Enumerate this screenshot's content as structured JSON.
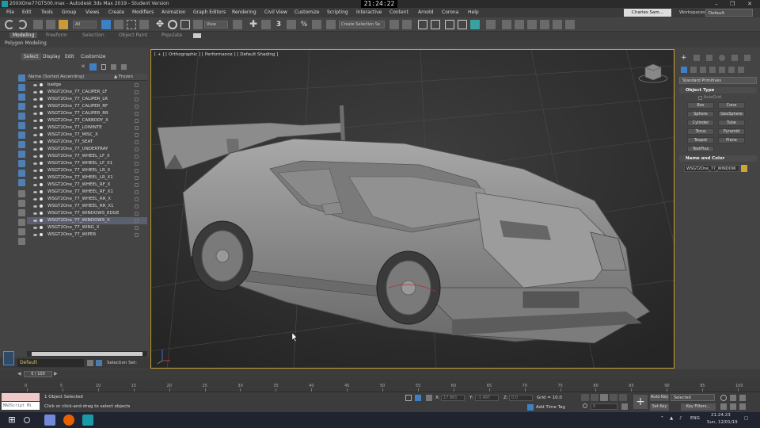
{
  "window": {
    "title": "20XXOne77GT500.max - Autodesk 3ds Max 2019 - Student Version",
    "clock": "21:24:22"
  },
  "menu": [
    "File",
    "Edit",
    "Tools",
    "Group",
    "Views",
    "Create",
    "Modifiers",
    "Animation",
    "Graph Editors",
    "Rendering",
    "Civil View",
    "Customize",
    "Scripting",
    "Interactive",
    "Content",
    "Arnold",
    "Corona",
    "Help"
  ],
  "user": {
    "name": "Charles Sam..."
  },
  "workspaces": {
    "label": "Workspaces:",
    "value": "Default"
  },
  "toolbar": {
    "filter_value": "All",
    "view_value": "View",
    "selection_set": "Create Selection Se"
  },
  "ribbon": {
    "tabs": [
      "Modeling",
      "Freeform",
      "Selection",
      "Object Paint",
      "Populate"
    ],
    "active": "Modeling",
    "sub": "Polygon Modeling"
  },
  "explorer": {
    "tabs": [
      "Select",
      "Display",
      "Edit",
      "Customize"
    ],
    "header_name": "Name (Sorted Ascending)",
    "header_frozen": "▲ Frozen",
    "items": [
      "badge",
      "WSGT2One_77_CALIPER_LF",
      "WSGT2One_77_CALIPER_LR",
      "WSGT2One_77_CALIPER_RF",
      "WSGT2One_77_CALIPER_RR",
      "WSGT2One_77_CARBODY_X",
      "WSGT2One_77_LOWINTE",
      "WSGT2One_77_MISC_X",
      "WSGT2One_77_SEAT",
      "WSGT2One_77_UNDERTRAY",
      "WSGT2One_77_WHEEL_LF_X",
      "WSGT2One_77_WHEEL_LF_X1",
      "WSGT2One_77_WHEEL_LR_X",
      "WSGT2One_77_WHEEL_LR_X1",
      "WSGT2One_77_WHEEL_RF_X",
      "WSGT2One_77_WHEEL_RF_X1",
      "WSGT2One_77_WHEEL_RR_X",
      "WSGT2One_77_WHEEL_RR_X1",
      "WSGT2One_77_WINDOWS_EDGE",
      "WSGT2One_77_WINDOWS_X",
      "WSGT2One_77_WING_X",
      "WSGT2One_77_WIPER"
    ],
    "selected_index": 19,
    "layer": "Default",
    "selection_set_label": "Selection Set:"
  },
  "viewport": {
    "label": "[ + ] [ Orthographic ] [ Performance ] [ Default Shading ]"
  },
  "command_panel": {
    "dropdown": "Standard Primitives",
    "object_type_title": "Object Type",
    "autogrid": "AutoGrid",
    "buttons": [
      "Box",
      "Cone",
      "Sphere",
      "GeoSphere",
      "Cylinder",
      "Tube",
      "Torus",
      "Pyramid",
      "Teapot",
      "Plane",
      "TextPlus"
    ],
    "name_color_title": "Name and Color",
    "object_name": "WSGT2One_77_WINDOW",
    "swatch_color": "#c9a834"
  },
  "timeline": {
    "frame_display": "0 / 100",
    "ticks": [
      "0",
      "5",
      "10",
      "15",
      "20",
      "25",
      "30",
      "35",
      "40",
      "45",
      "50",
      "55",
      "60",
      "65",
      "70",
      "75",
      "80",
      "85",
      "90",
      "95",
      "100"
    ]
  },
  "status": {
    "maxscript": "MAXScript Mi",
    "selection_info": "1 Object Selected",
    "prompt": "Click or click-and-drag to select objects",
    "x_label": "X:",
    "x_value": "17.961",
    "y_label": "Y:",
    "y_value": "-1.497",
    "z_label": "Z:",
    "z_value": "0.0",
    "grid": "Grid = 10.0",
    "add_time_tag": "Add Time Tag",
    "frame_field": "0",
    "auto_key": "Auto Key",
    "set_key": "Set Key",
    "key_mode": "Selected",
    "key_filters": "Key Filters..."
  },
  "taskbar": {
    "lang": "ENG",
    "time": "21:24:23",
    "date": "Sun, 12/01/19"
  }
}
